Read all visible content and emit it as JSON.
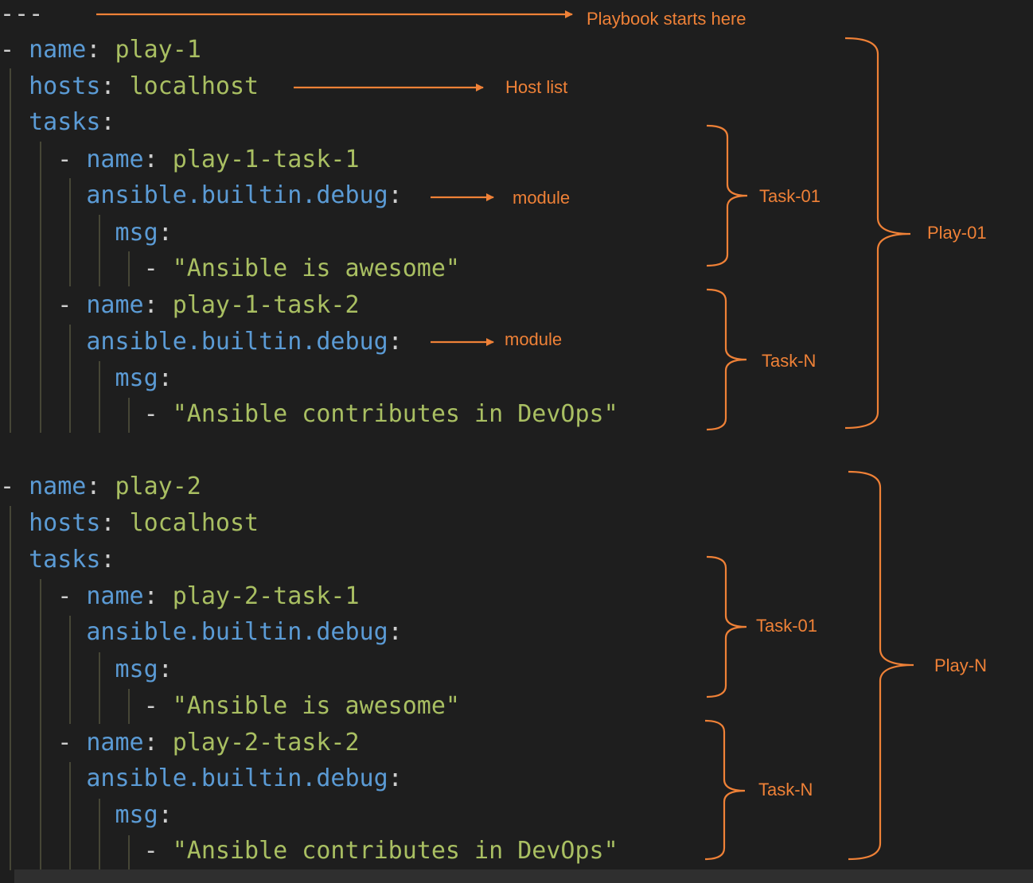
{
  "document": {
    "separator": "---",
    "plays": [
      {
        "name_key": "name",
        "name_value": "play-1",
        "hosts_key": "hosts",
        "hosts_value": "localhost",
        "tasks_key": "tasks",
        "tasks": [
          {
            "name_key": "name",
            "name_value": "play-1-task-1",
            "module": "ansible.builtin.debug",
            "param_key": "msg",
            "item": "\"Ansible is awesome\""
          },
          {
            "name_key": "name",
            "name_value": "play-1-task-2",
            "module": "ansible.builtin.debug",
            "param_key": "msg",
            "item": "\"Ansible contributes in DevOps\""
          }
        ]
      },
      {
        "name_key": "name",
        "name_value": "play-2",
        "hosts_key": "hosts",
        "hosts_value": "localhost",
        "tasks_key": "tasks",
        "tasks": [
          {
            "name_key": "name",
            "name_value": "play-2-task-1",
            "module": "ansible.builtin.debug",
            "param_key": "msg",
            "item": "\"Ansible is awesome\""
          },
          {
            "name_key": "name",
            "name_value": "play-2-task-2",
            "module": "ansible.builtin.debug",
            "param_key": "msg",
            "item": "\"Ansible contributes in DevOps\""
          }
        ]
      }
    ]
  },
  "annotations": {
    "playbook_start": "Playbook starts here",
    "host_list": "Host list",
    "module_1": "module",
    "module_2": "module",
    "play1_task1": "Task-01",
    "play1_taskn": "Task-N",
    "play1": "Play-01",
    "play2_task1": "Task-01",
    "play2_taskn": "Task-N",
    "playn": "Play-N"
  },
  "colors": {
    "background": "#1e1e1e",
    "key": "#5b9bd5",
    "value": "#a9bf62",
    "annotation": "#ef8137",
    "indent_guide": "#464636"
  }
}
